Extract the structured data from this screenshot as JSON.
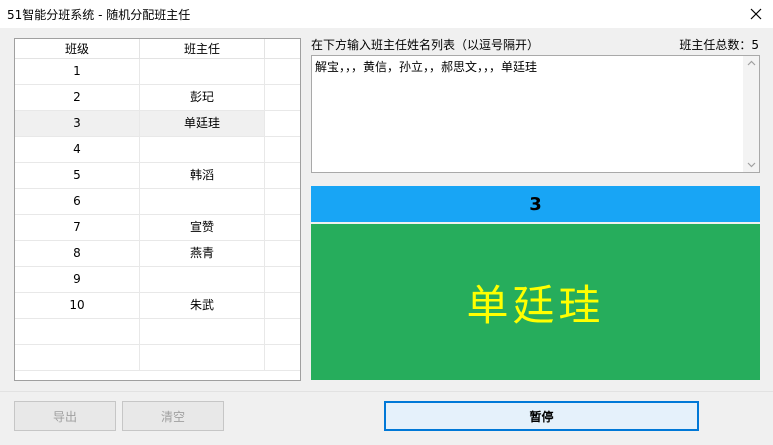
{
  "window": {
    "title": "51智能分班系统 - 随机分配班主任"
  },
  "grid": {
    "headers": [
      "班级",
      "班主任"
    ],
    "rows": [
      {
        "class": "1",
        "teacher": ""
      },
      {
        "class": "2",
        "teacher": "彭玘"
      },
      {
        "class": "3",
        "teacher": "单廷珪"
      },
      {
        "class": "4",
        "teacher": ""
      },
      {
        "class": "5",
        "teacher": "韩滔"
      },
      {
        "class": "6",
        "teacher": ""
      },
      {
        "class": "7",
        "teacher": "宣赞"
      },
      {
        "class": "8",
        "teacher": "燕青"
      },
      {
        "class": "9",
        "teacher": ""
      },
      {
        "class": "10",
        "teacher": "朱武"
      },
      {
        "class": "",
        "teacher": ""
      },
      {
        "class": "",
        "teacher": ""
      }
    ],
    "selected_index": 2
  },
  "input": {
    "label": "在下方输入班主任姓名列表（以逗号隔开）",
    "count_label": "班主任总数：",
    "count": "5",
    "value": "解宝，，，黄信，孙立，，郝思文，，，单廷珪"
  },
  "result": {
    "number": "3",
    "name": "单廷珪",
    "number_bg": "#18a5f5",
    "name_bg": "#26ad5c",
    "name_color": "#ffff00"
  },
  "buttons": {
    "export": "导出",
    "clear": "清空",
    "pause": "暂停"
  }
}
